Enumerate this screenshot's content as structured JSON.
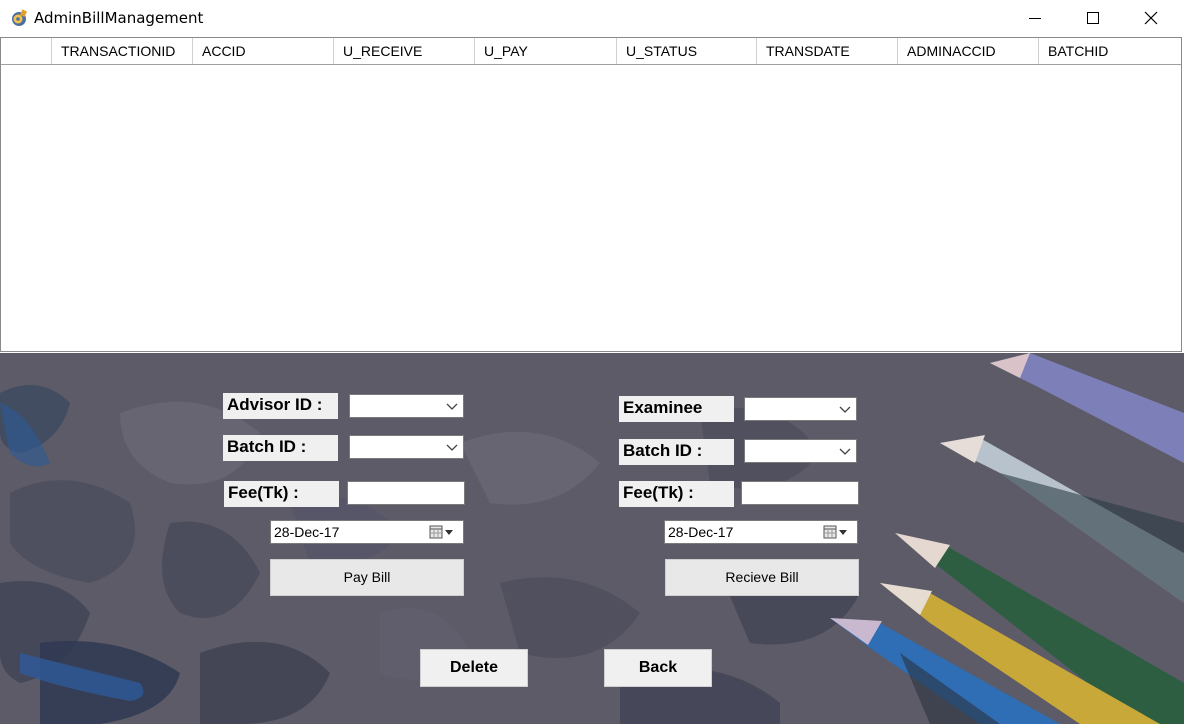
{
  "window": {
    "title": "AdminBillManagement"
  },
  "grid": {
    "columns": [
      "TRANSACTIONID",
      "ACCID",
      "U_RECEIVE",
      "U_PAY",
      "U_STATUS",
      "TRANSDATE",
      "ADMINACCID",
      "BATCHID"
    ],
    "rows": []
  },
  "left_form": {
    "advisor_label": "Advisor ID :",
    "advisor_value": "",
    "batch_label": "Batch ID :",
    "batch_value": "",
    "fee_label": "Fee(Tk) :",
    "fee_value": "",
    "date_value": "28-Dec-17",
    "pay_button": "Pay Bill"
  },
  "right_form": {
    "examinee_label": "Examinee",
    "examinee_value": "",
    "batch_label": "Batch ID :",
    "batch_value": "",
    "fee_label": "Fee(Tk) :",
    "fee_value": "",
    "date_value": "28-Dec-17",
    "receive_button": "Recieve Bill"
  },
  "footer": {
    "delete_button": "Delete",
    "back_button": "Back"
  },
  "colors": {
    "panel_background": "#5c5b67",
    "label_background": "#f0f0f0"
  }
}
